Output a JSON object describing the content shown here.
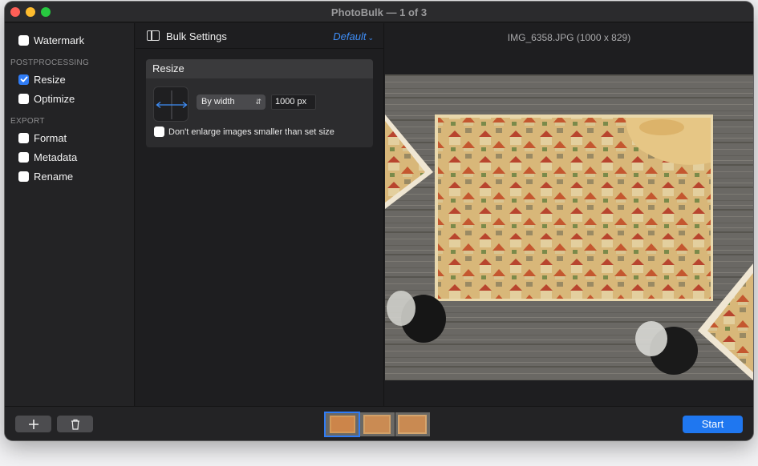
{
  "window": {
    "title": "PhotoBulk — 1 of 3"
  },
  "sidebar": {
    "items_top": [
      {
        "label": "Watermark",
        "checked": false
      }
    ],
    "postprocessing_label": "POSTPROCESSING",
    "postprocessing": [
      {
        "label": "Resize",
        "checked": true
      },
      {
        "label": "Optimize",
        "checked": false
      }
    ],
    "export_label": "EXPORT",
    "export": [
      {
        "label": "Format",
        "checked": false
      },
      {
        "label": "Metadata",
        "checked": false
      },
      {
        "label": "Rename",
        "checked": false
      }
    ]
  },
  "settings": {
    "title": "Bulk Settings",
    "preset": "Default",
    "resize": {
      "header": "Resize",
      "mode": "By width",
      "value": "1000 px",
      "enlarge_label": "Don't enlarge images smaller than set size",
      "enlarge_checked": false
    }
  },
  "preview": {
    "filename": "IMG_6358.JPG (1000 x 829)"
  },
  "bottombar": {
    "start_label": "Start",
    "thumbnail_count": 3,
    "selected_thumbnail": 1
  },
  "colors": {
    "accent": "#2f7cf6",
    "start_button": "#1f77f0"
  }
}
